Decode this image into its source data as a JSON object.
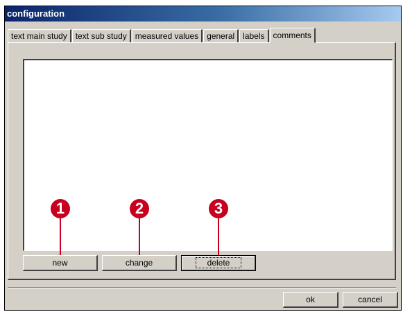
{
  "window": {
    "title": "configuration"
  },
  "tabs": [
    {
      "label": "text main study"
    },
    {
      "label": "text sub study"
    },
    {
      "label": "measured values"
    },
    {
      "label": "general"
    },
    {
      "label": "labels"
    },
    {
      "label": "comments",
      "active": true
    }
  ],
  "comments_list": {
    "items": []
  },
  "actions": {
    "new_label": "new",
    "change_label": "change",
    "delete_label": "delete"
  },
  "callouts": [
    {
      "number": "1"
    },
    {
      "number": "2"
    },
    {
      "number": "3"
    }
  ],
  "dialog": {
    "ok_label": "ok",
    "cancel_label": "cancel"
  },
  "colors": {
    "callout": "#c8001e",
    "title_bar": "#0a246a",
    "face": "#d4d0c8"
  }
}
